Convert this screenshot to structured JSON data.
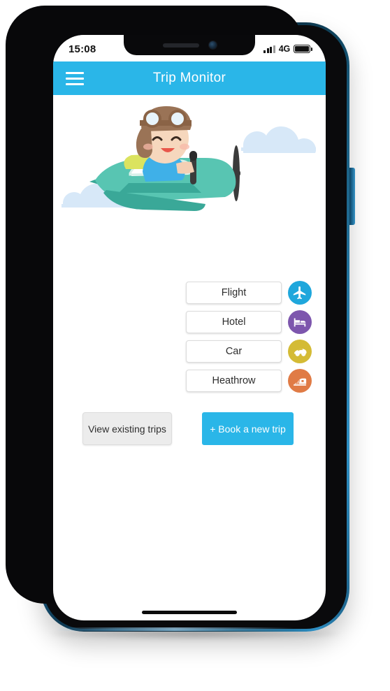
{
  "device": {
    "frame_color": "#1d6e9c",
    "bezel_color": "#09090b",
    "screen_bg": "#ffffff"
  },
  "status_bar": {
    "time": "15:08",
    "network_label": "4G",
    "signal_icon": "signal-bars-icon",
    "battery_icon": "battery-full-icon"
  },
  "app_bar": {
    "title": "Trip Monitor",
    "menu_icon": "hamburger-menu-icon",
    "bg_color": "#2ab6e8",
    "title_color": "#ffffff"
  },
  "illustration": {
    "alt": "pilot-flying-airplane-illustration",
    "plane_color": "#4cc0ae",
    "plane_shadow_color": "#169b87",
    "cloud_color": "#d7e8f8",
    "scarf_color": "#dbe35f",
    "shirt_color": "#3fb0e8",
    "cap_color": "#9a7356"
  },
  "options": [
    {
      "label": "Flight",
      "icon": "airplane-icon",
      "color": "#1fa7dc"
    },
    {
      "label": "Hotel",
      "icon": "bed-icon",
      "color": "#7d56ad"
    },
    {
      "label": "Car",
      "icon": "car-icon",
      "color": "#d4bb35"
    },
    {
      "label": "Heathrow",
      "icon": "train-icon",
      "color": "#e07b45"
    }
  ],
  "actions": {
    "view_existing_label": "View existing trips",
    "book_new_label": "+ Book a new trip",
    "primary_color": "#2ab6e8",
    "secondary_color": "#ececec"
  },
  "home_indicator": {
    "visible": true
  }
}
